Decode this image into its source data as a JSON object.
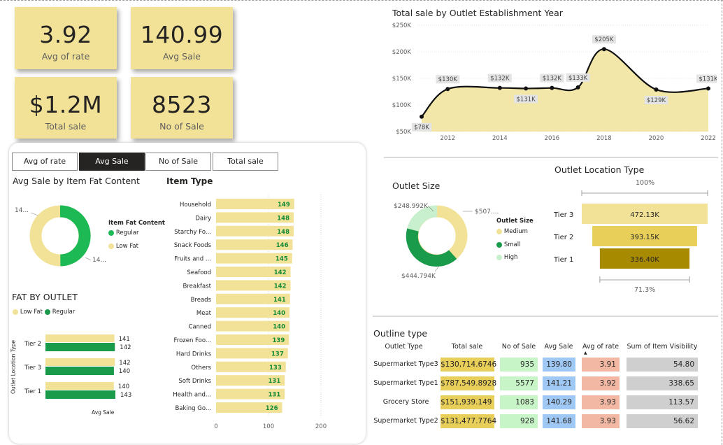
{
  "kpis": [
    {
      "value": "3.92",
      "label": "Avg of rate"
    },
    {
      "value": "140.99",
      "label": "Avg Sale"
    },
    {
      "value": "$1.2M",
      "label": "Total sale"
    },
    {
      "value": "8523",
      "label": "No of Sale"
    }
  ],
  "slicer": {
    "items": [
      "Avg of rate",
      "Avg Sale",
      "No of Sale",
      "Total sale"
    ],
    "selected": "Avg Sale"
  },
  "fat_donut": {
    "title": "Avg Sale by Item Fat Content",
    "legend_title": "Item Fat Content",
    "label_left": "14...",
    "label_right": "14...",
    "legend": [
      "Regular",
      "Low Fat"
    ]
  },
  "fat_by_outlet": {
    "title": "FAT BY OUTLET",
    "legend": [
      "Low Fat",
      "Regular"
    ],
    "y_axis_label": "Outlet Location Type",
    "x_axis_label": "Avg Sale"
  },
  "item_type": {
    "title": "Item Type",
    "ticks": [
      "0",
      "100",
      "200"
    ]
  },
  "year_chart": {
    "title": "Total sale by Outlet Establishment Year",
    "y_ticks": [
      "$250K",
      "$200K",
      "$150K",
      "$100K",
      "$50K"
    ],
    "x_ticks": [
      "2012",
      "2014",
      "2016",
      "2018",
      "2020",
      "2022"
    ]
  },
  "outlet_size": {
    "title": "Outlet Size",
    "legend_title": "Outlet Size",
    "legend": [
      "Medium",
      "Small",
      "High"
    ],
    "labels": [
      "$248.992K",
      "$507....",
      "$444.794K"
    ]
  },
  "location_funnel": {
    "title": "Outlet Location Type",
    "top_pct": "100%",
    "bottom_pct": "71.3%"
  },
  "outline_table": {
    "title": "Outline type",
    "headers": [
      "Outlet Type",
      "Total sale",
      "No of Sale",
      "Avg Sale",
      "Avg of rate",
      "Sum of Item Visibility"
    ],
    "rows": [
      [
        "Supermarket Type3",
        "$130,714.6746",
        "935",
        "139.80",
        "3.91",
        "54.80"
      ],
      [
        "Supermarket Type1",
        "$787,549.8928",
        "5577",
        "141.21",
        "3.92",
        "338.65"
      ],
      [
        "Grocery Store",
        "$151,939.149",
        "1083",
        "140.29",
        "3.93",
        "113.57"
      ],
      [
        "Supermarket Type2",
        "$131,477.7764",
        "928",
        "141.68",
        "3.93",
        "56.62"
      ]
    ]
  },
  "colors": {
    "kpi_bg": "#f2e298",
    "regular_green": "#1db954",
    "low_fat": "#f2e298",
    "dark_green": "#1a9b4b",
    "light_green": "#c8f0cf",
    "gold": "#e8cf5a",
    "dark_gold": "#a88a00"
  },
  "chart_data": [
    {
      "type": "line",
      "title": "Total sale by Outlet Establishment Year",
      "x": [
        2011,
        2012,
        2014,
        2015,
        2016,
        2017,
        2018,
        2020,
        2022
      ],
      "values": [
        78,
        130,
        132,
        131,
        132,
        133,
        205,
        129,
        131
      ],
      "data_labels": [
        "$78K",
        "$130K",
        "$132K",
        "$131K",
        "$132K",
        "$133K",
        "$205K",
        "$129K",
        "$131K"
      ],
      "ylim": [
        50,
        250
      ],
      "y_unit": "K"
    },
    {
      "type": "bar",
      "title": "Item Type",
      "categories": [
        "Household",
        "Dairy",
        "Starchy Fo...",
        "Snack Foods",
        "Fruits and ...",
        "Seafood",
        "Breakfast",
        "Breads",
        "Meat",
        "Canned",
        "Frozen Foo...",
        "Hard Drinks",
        "Others",
        "Soft Drinks",
        "Health and...",
        "Baking Go..."
      ],
      "values": [
        149,
        148,
        148,
        146,
        145,
        142,
        142,
        141,
        140,
        140,
        139,
        137,
        133,
        131,
        131,
        126
      ],
      "xlim": [
        0,
        200
      ]
    },
    {
      "type": "bar",
      "title": "FAT BY OUTLET",
      "categories": [
        "Tier 2",
        "Tier 3",
        "Tier 1"
      ],
      "series": [
        {
          "name": "Low Fat",
          "values": [
            141,
            142,
            140
          ]
        },
        {
          "name": "Regular",
          "values": [
            142,
            140,
            143
          ]
        }
      ]
    },
    {
      "type": "bar",
      "title": "Outlet Location Type",
      "categories": [
        "Tier 3",
        "Tier 2",
        "Tier 1"
      ],
      "values": [
        472.13,
        393.15,
        336.4
      ],
      "data_labels": [
        "472.13K",
        "393.15K",
        "336.40K"
      ]
    },
    {
      "type": "pie",
      "title": "Outlet Size",
      "categories": [
        "Medium",
        "Small",
        "High"
      ],
      "values": [
        507,
        444.794,
        248.992
      ]
    },
    {
      "type": "pie",
      "title": "Avg Sale by Item Fat Content",
      "categories": [
        "Regular",
        "Low Fat"
      ],
      "values": [
        50.1,
        49.9
      ]
    }
  ]
}
